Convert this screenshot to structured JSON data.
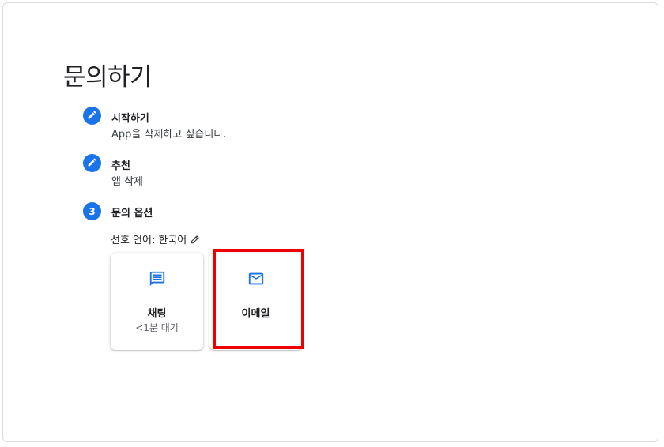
{
  "page": {
    "title": "문의하기"
  },
  "steps": [
    {
      "title": "시작하기",
      "subtitle": "App을 삭제하고 싶습니다.",
      "icon": "pencil-icon"
    },
    {
      "title": "추천",
      "subtitle": "앱 삭제",
      "icon": "pencil-icon"
    },
    {
      "title": "문의 옵션",
      "number": "3"
    }
  ],
  "language": {
    "label": "선호 언어:",
    "value": "한국어"
  },
  "options": [
    {
      "label": "채팅",
      "subtitle": "<1분 대기",
      "icon": "chat-icon"
    },
    {
      "label": "이메일",
      "icon": "mail-icon"
    }
  ],
  "colors": {
    "accent": "#1a73e8",
    "highlight": "#ee0000"
  }
}
